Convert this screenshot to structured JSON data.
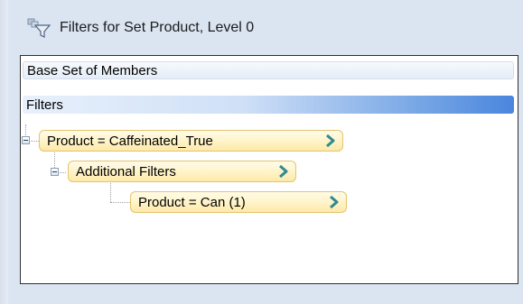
{
  "header": {
    "title": "Filters for Set Product, Level 0",
    "icon": "filter-funnel-icon"
  },
  "panel": {
    "base_set_label": "Base Set of Members",
    "filters_label": "Filters"
  },
  "tree": {
    "nodes": [
      {
        "label": "Product = Caffeinated_True",
        "level": 0,
        "expanded": true
      },
      {
        "label": "Additional Filters",
        "level": 1,
        "expanded": true
      },
      {
        "label": "Product = Can (1)",
        "level": 2
      }
    ]
  },
  "colors": {
    "node_fill": "#fff3c6",
    "node_border": "#e3c46c",
    "chevron": "#2f8a8f",
    "filters_highlight": "#4a86de",
    "window_bg": "#dbe5f2"
  }
}
